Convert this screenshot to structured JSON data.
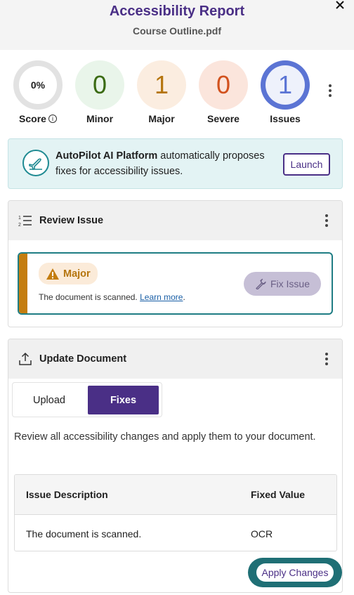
{
  "header": {
    "title": "Accessibility Report",
    "filename": "Course Outline.pdf"
  },
  "stats": {
    "score": {
      "value": "0%",
      "label": "Score",
      "info_icon": "i"
    },
    "minor": {
      "value": "0",
      "label": "Minor"
    },
    "major": {
      "value": "1",
      "label": "Major"
    },
    "severe": {
      "value": "0",
      "label": "Severe"
    },
    "issues": {
      "value": "1",
      "label": "Issues"
    }
  },
  "banner": {
    "brand": "AutoPilot AI Platform",
    "text": " automatically proposes fixes for accessibility issues.",
    "launch_label": "Launch"
  },
  "review": {
    "title": "Review Issue",
    "severity": "Major",
    "issue_text": "The document is scanned.",
    "learn_more": "Learn more",
    "period": ".",
    "fix_label": "Fix Issue"
  },
  "update": {
    "title": "Update Document",
    "tabs": [
      "Upload",
      "Fixes"
    ],
    "selected_tab": "Fixes",
    "description": "Review all accessibility changes and apply them to your document.",
    "table": {
      "headers": [
        "Issue Description",
        "Fixed Value"
      ],
      "rows": [
        [
          "The document is scanned.",
          "OCR"
        ]
      ]
    },
    "apply_label": "Apply Changes"
  },
  "colors": {
    "brand_purple": "#4a2f86",
    "teal": "#1f7d84",
    "major_orange": "#c47d0f",
    "minor_green": "#3b6b14",
    "severe_red": "#d2521e",
    "issues_blue": "#5b74d4"
  },
  "icons": [
    "close-icon",
    "info-icon",
    "more-vertical-icon",
    "airplane-icon",
    "numbered-list-icon",
    "warning-triangle-icon",
    "wrench-icon",
    "upload-icon"
  ]
}
